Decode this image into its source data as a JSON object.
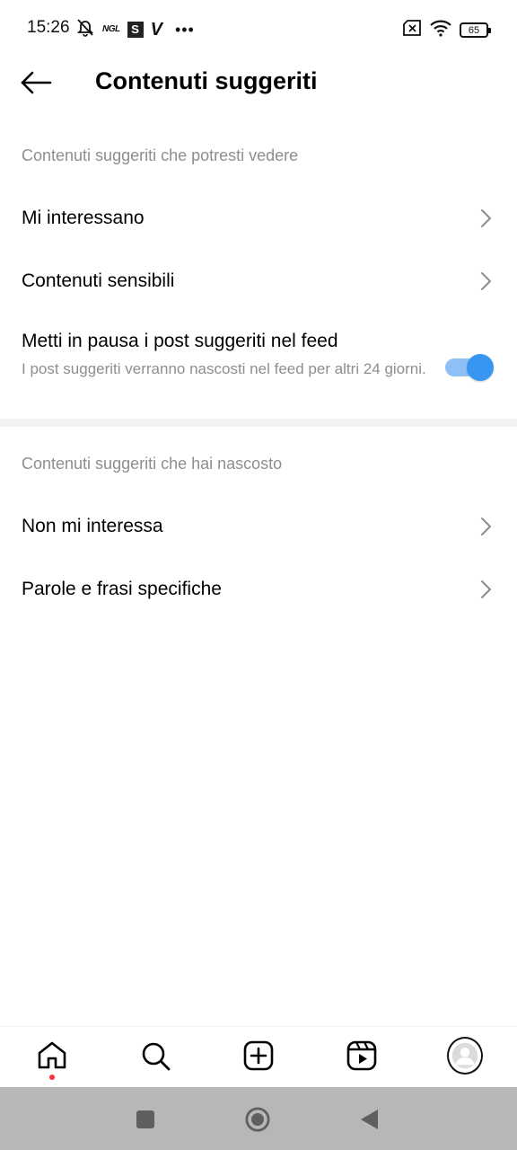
{
  "status_bar": {
    "time": "15:26",
    "ngl_label": "NGL",
    "s_badge": "S",
    "v_label": "V",
    "more_dots": "•••",
    "battery_level": "65",
    "icons": [
      "mute-bell-icon",
      "ngl-icon",
      "s-app-icon",
      "v-app-icon",
      "more-icon",
      "no-sim-icon",
      "wifi-icon",
      "battery-icon"
    ]
  },
  "header": {
    "title": "Contenuti suggeriti",
    "back_icon": "arrow-left-icon"
  },
  "section_1": {
    "label": "Contenuti suggeriti che potresti vedere",
    "items": [
      {
        "label": "Mi interessano"
      },
      {
        "label": "Contenuti sensibili"
      }
    ],
    "toggle": {
      "title": "Metti in pausa i post suggeriti nel feed",
      "description": "I post suggeriti verranno nascosti nel feed per altri 24 giorni.",
      "enabled": true
    }
  },
  "section_2": {
    "label": "Contenuti suggeriti che hai nascosto",
    "items": [
      {
        "label": "Non mi interessa"
      },
      {
        "label": "Parole e frasi specifiche"
      }
    ]
  },
  "bottom_nav": {
    "items": [
      "home-icon",
      "search-icon",
      "create-post-icon",
      "reels-icon",
      "profile-avatar"
    ],
    "active": "home-icon"
  },
  "system_nav": {
    "items": [
      "recents-square-icon",
      "home-circle-icon",
      "back-triangle-icon"
    ]
  },
  "colors": {
    "accent": "#3797f0",
    "accent_track": "#8ec0f5",
    "secondary_text": "#8e8e8e",
    "notification_dot": "#ff3040",
    "system_nav_bg": "#b7b7b7"
  }
}
